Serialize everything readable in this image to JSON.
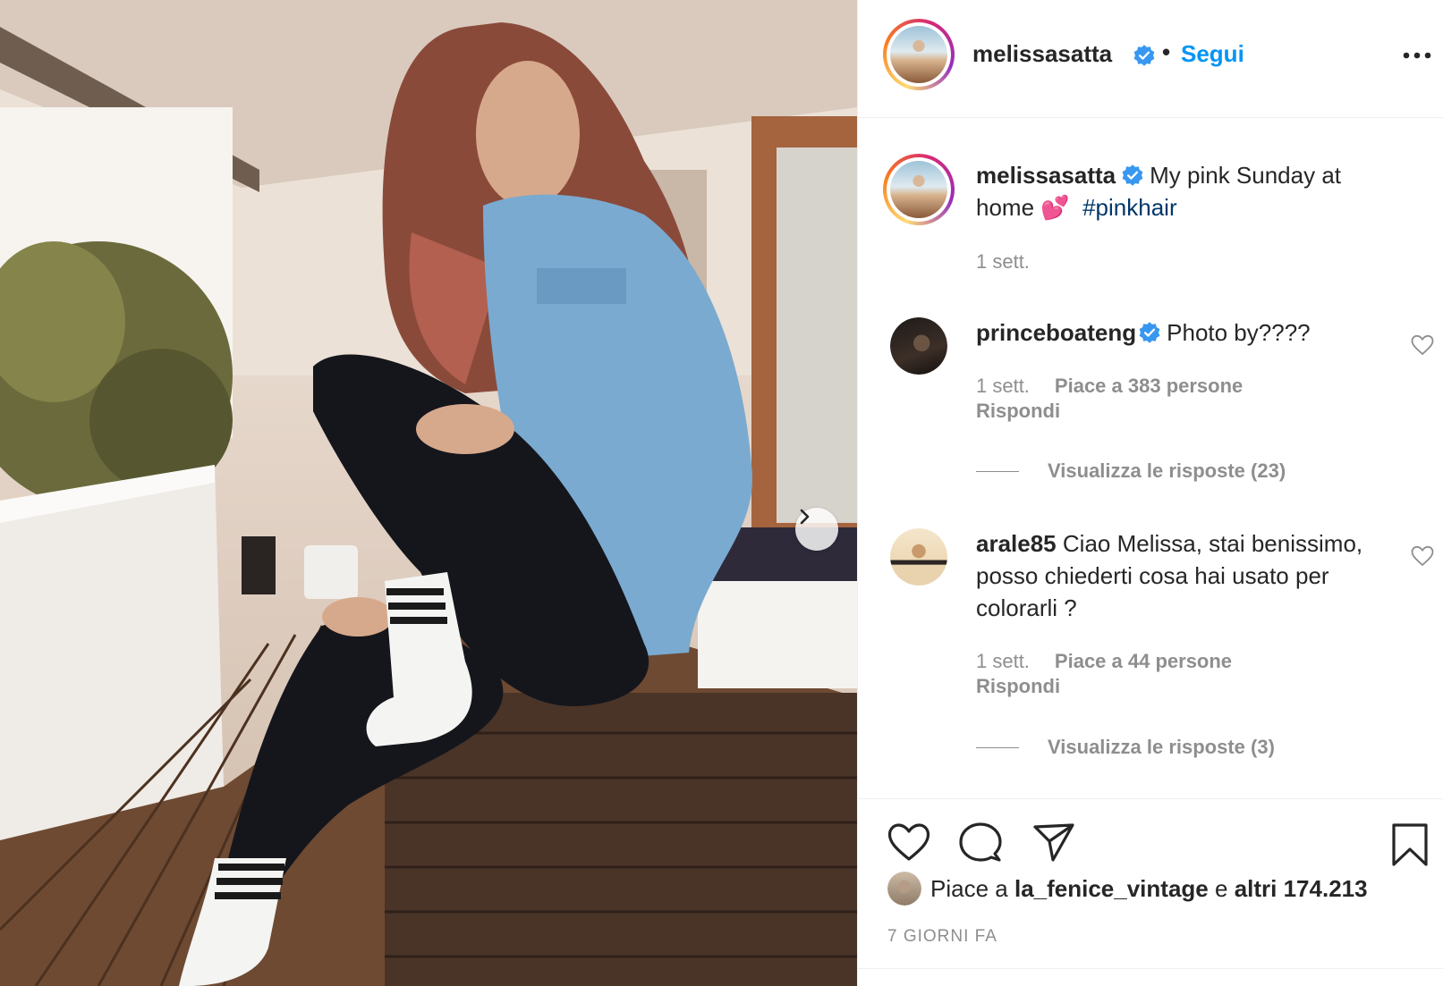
{
  "post": {
    "username": "melissasatta",
    "separator": "•",
    "follow_label": "Segui",
    "caption_prefix": "My pink Sunday at home ",
    "caption_emoji": "💕",
    "hashtag": "#pinkhair",
    "caption_time": "1 sett."
  },
  "comments": [
    {
      "username": "princeboateng",
      "verified": true,
      "text": "Photo by????",
      "time": "1 sett.",
      "likes": "Piace a 383 persone",
      "reply": "Rispondi",
      "view_replies": "Visualizza le risposte (23)"
    },
    {
      "username": "arale85",
      "verified": false,
      "text": "Ciao Melissa, stai benissimo, posso chiederti cosa hai usato per colorarli ?",
      "time": "1 sett.",
      "likes": "Piace a 44 persone",
      "reply": "Rispondi",
      "view_replies": "Visualizza le risposte (3)"
    }
  ],
  "likes": {
    "prefix": "Piace a",
    "user": "la_fenice_vintage",
    "connector": "e",
    "others": "altri 174.213"
  },
  "date": "7 GIORNI FA",
  "icons": {
    "verified": "verified-badge-icon",
    "more": "more-options-icon",
    "like": "heart-icon",
    "comment": "comment-icon",
    "share": "share-icon",
    "save": "bookmark-icon",
    "next": "chevron-right-icon"
  },
  "colors": {
    "accent": "#0095f6",
    "hashtag": "#00376b",
    "secondary_text": "#8e8e8e",
    "verified": "#3897f0"
  }
}
